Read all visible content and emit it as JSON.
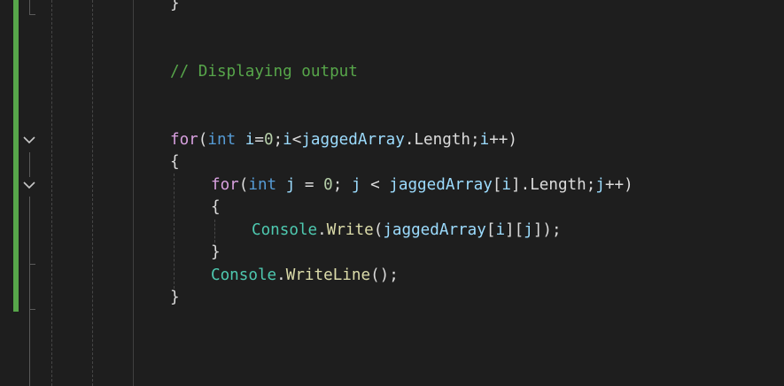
{
  "editor": {
    "colors": {
      "background": "#1e1e1e",
      "change_bar": "#57a64a",
      "keyword": "#d8a0df",
      "type": "#569cd6",
      "variable": "#9cdcfe",
      "number": "#b5cea8",
      "class": "#4ec9b0",
      "method": "#dcdcaa",
      "comment": "#57a64a",
      "plain": "#dcdcdc"
    },
    "icons": [
      "collapse-chevron-icon"
    ],
    "lines": {
      "l1": {
        "brace": "}"
      },
      "l2": {
        "comment": "// Displaying output"
      },
      "l3": {
        "kw": "for",
        "p1": "(",
        "type": "int",
        "sp": " ",
        "v1": "i",
        "op1": "=",
        "n1": "0",
        "p2": ";",
        "v2": "i",
        "op2": "<",
        "arr": "jaggedArray",
        "dot": ".",
        "prop": "Length",
        "p3": ";",
        "v3": "i",
        "op3": "++",
        "p4": ")"
      },
      "l4": {
        "brace": "{"
      },
      "l5": {
        "kw": "for",
        "p1": "(",
        "type": "int",
        "sp": " ",
        "v1": "j",
        "op1": " = ",
        "n1": "0",
        "p2": "; ",
        "v2": "j",
        "op2": " < ",
        "arr": "jaggedArray",
        "b1": "[",
        "idx": "i",
        "b2": "]",
        "dot": ".",
        "prop": "Length",
        "p3": ";",
        "v3": "j",
        "op3": "++",
        "p4": ")"
      },
      "l6": {
        "brace": "{"
      },
      "l7": {
        "cls": "Console",
        "dot": ".",
        "mth": "Write",
        "p1": "(",
        "arr": "jaggedArray",
        "b1": "[",
        "i": "i",
        "b2": "][",
        "j": "j",
        "b3": "]",
        "p2": ");"
      },
      "l8": {
        "brace": "}"
      },
      "l9": {
        "cls": "Console",
        "dot": ".",
        "mth": "WriteLine",
        "p1": "();"
      },
      "l10": {
        "brace": "}"
      }
    }
  }
}
